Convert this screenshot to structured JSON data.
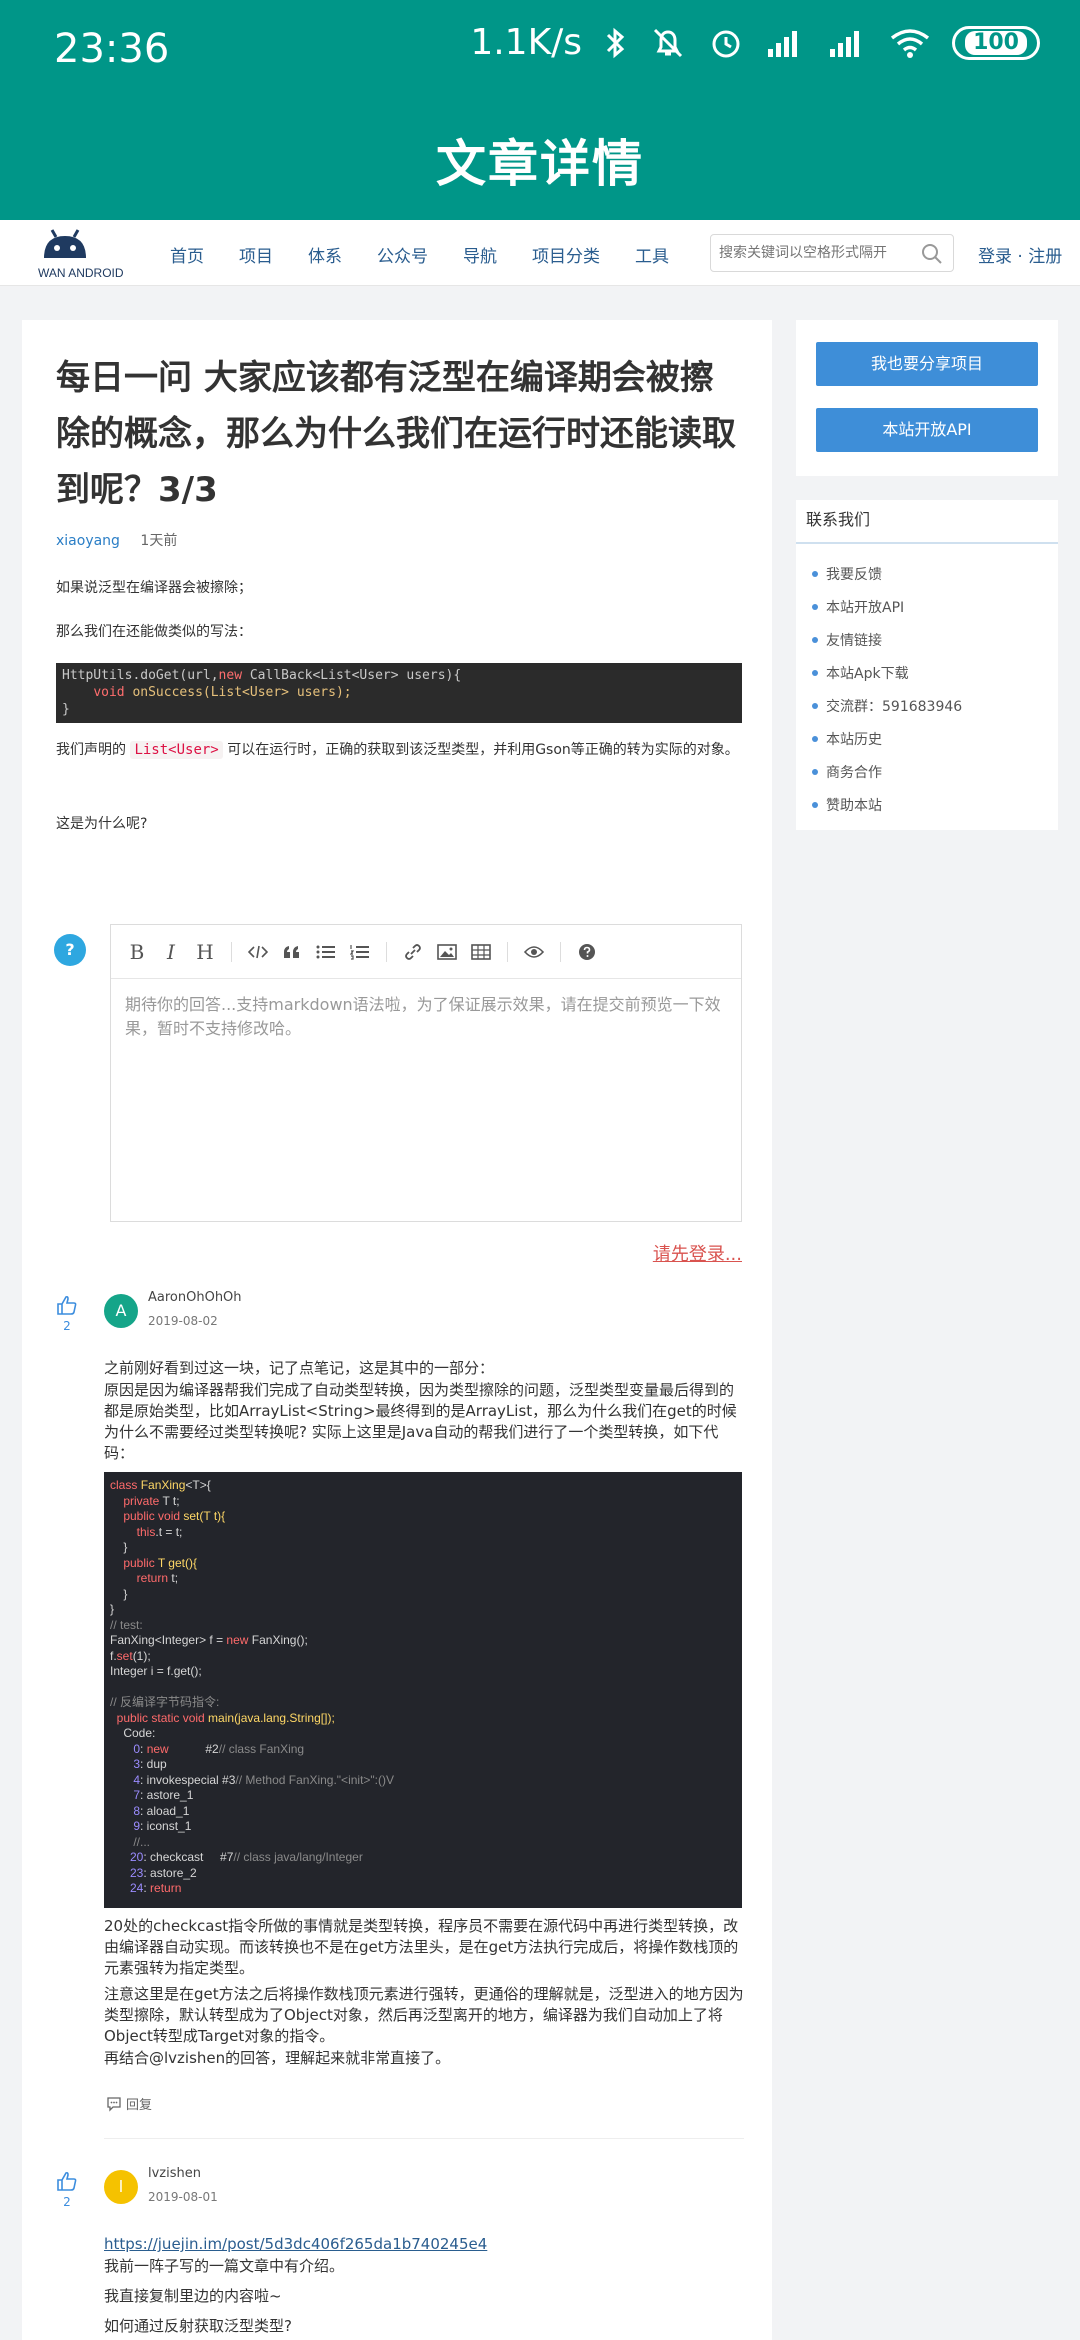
{
  "status_bar": {
    "time": "23:36",
    "net_speed": "1.1K/s",
    "battery": "100",
    "icons": [
      "bluetooth-icon",
      "mute-icon",
      "alarm-icon",
      "signal-icon",
      "signal-icon",
      "wifi-icon",
      "battery-icon"
    ]
  },
  "app_bar": {
    "title": "文章详情"
  },
  "header": {
    "logo_text": "WAN ANDROID",
    "nav": [
      "首页",
      "项目",
      "体系",
      "公众号",
      "导航",
      "项目分类",
      "工具"
    ],
    "search_placeholder": "搜索关键词以空格形式隔开",
    "auth": "登录 · 注册"
  },
  "article": {
    "title": "每日一问 大家应该都有泛型在编译期会被擦除的概念，那么为什么我们在运行时还能读取到呢？3/3",
    "author": "xiaoyang",
    "time": "1天前",
    "p1": "如果说泛型在编译器会被擦除；",
    "p2": "那么我们在还能做类似的写法：",
    "code_line1_a": "HttpUtils.doGet(url,",
    "code_line1_kw": "new",
    "code_line1_b": " CallBack<List<User> users){",
    "code_line2_kw": "void",
    "code_line2_fn": "onSuccess",
    "code_line2_b": "(List<User> users);",
    "code_line3": "}",
    "p3_before": "我们声明的 ",
    "p3_code": "List<User>",
    "p3_after": " 可以在运行时，正确的获取到该泛型类型，并利用Gson等正确的转为实际的对象。",
    "p4": "这是为什么呢?"
  },
  "editor": {
    "badge": "?",
    "placeholder": "期待你的回答...支持markdown语法啦，为了保证展示效果，请在提交前预览一下效果，暂时不支持修改哈。",
    "toolbar": [
      "B",
      "I",
      "H"
    ],
    "login_link": "请先登录..."
  },
  "comments": [
    {
      "likes": "2",
      "avatar": "A",
      "avatar_color": "#15a589",
      "user": "AaronOhOhOh",
      "date": "2019-08-02",
      "text1": "之前刚好看到过这一块，记了点笔记，这是其中的一部分：",
      "text2": "原因是因为编译器帮我们完成了自动类型转换，因为类型擦除的问题，泛型类型变量最后得到的都是原始类型，比如ArrayList<String>最终得到的是ArrayList，那么为什么我们在get的时候为什么不需要经过类型转换呢? 实际上这里是Java自动的帮我们进行了一个类型转换，如下代码：",
      "text3": "20处的checkcast指令所做的事情就是类型转换，程序员不需要在源代码中再进行类型转换，改由编译器自动实现。而该转换也不是在get方法里头，是在get方法执行完成后，将操作数栈顶的元素强转为指定类型。",
      "text4": "注意这里是在get方法之后将操作数栈顶元素进行强转，更通俗的理解就是，泛型进入的地方因为类型擦除，默认转型成为了Object对象，然后再泛型离开的地方，编译器为我们自动加上了将Object转型成Target对象的指令。",
      "text5": "再结合@lvzishen的回答，理解起来就非常直接了。",
      "reply": "回复"
    },
    {
      "likes": "2",
      "avatar": "l",
      "avatar_color": "#f5c200",
      "user": "lvzishen",
      "date": "2019-08-01",
      "link": "https://juejin.im/post/5d3dc406f265da1b740245e4",
      "text1": "我前一阵子写的一篇文章中有介绍。",
      "text2": "我直接复制里边的内容啦~",
      "text3": "如何通过反射获取泛型类型?"
    }
  ],
  "code2": {
    "l1a": "class ",
    "l1b": "FanXing",
    "l1c": "<T>{",
    "l2a": "    private",
    "l2b": " T t;",
    "l3a": "    public void ",
    "l3b": "set",
    "l3c": "(T t){",
    "l4a": "        this",
    "l4b": ".t = t;",
    "l5": "    }",
    "l6a": "    public",
    "l6b": " T ",
    "l6c": "get",
    "l6d": "(){",
    "l7a": "        return",
    "l7b": " t;",
    "l8": "    }",
    "l9": "}",
    "l10": "// test:",
    "l11a": "FanXing<Integer> f = ",
    "l11b": "new",
    "l11c": " FanXing();",
    "l12a": "f.",
    "l12b": "set",
    "l12c": "(1);",
    "l13": "Integer i = f.get();",
    "l14": "",
    "l15": "// 反编译字节码指令:",
    "l16a": "  public static void ",
    "l16b": "main",
    "l16c": "(java.lang.String[]);",
    "l17": "    Code:",
    "l18a": "       0",
    "l18b": ": ",
    "l18c": "new",
    "l18d": "           #2",
    "l18e": "// class FanXing",
    "l19a": "       3",
    "l19b": ": dup",
    "l20a": "       4",
    "l20b": ": invokespecial #3",
    "l20c": "// Method FanXing.\"<init>\":()V",
    "l21a": "       7",
    "l21b": ": astore_1",
    "l22a": "       8",
    "l22b": ": aload_1",
    "l23a": "       9",
    "l23b": ": iconst_1",
    "l24": "       //...",
    "l25a": "      20",
    "l25b": ": checkcast     #7",
    "l25c": "// class java/lang/Integer",
    "l26a": "      23",
    "l26b": ": astore_2",
    "l27a": "      24",
    "l27b": ": ",
    "l27c": "return"
  },
  "sidebar": {
    "share_btn": "我也要分享项目",
    "api_btn": "本站开放API",
    "contact_title": "联系我们",
    "contact_items": [
      "我要反馈",
      "本站开放API",
      "友情链接",
      "本站Apk下载",
      "交流群：591683946",
      "本站历史",
      "商务合作",
      "赞助本站"
    ]
  }
}
